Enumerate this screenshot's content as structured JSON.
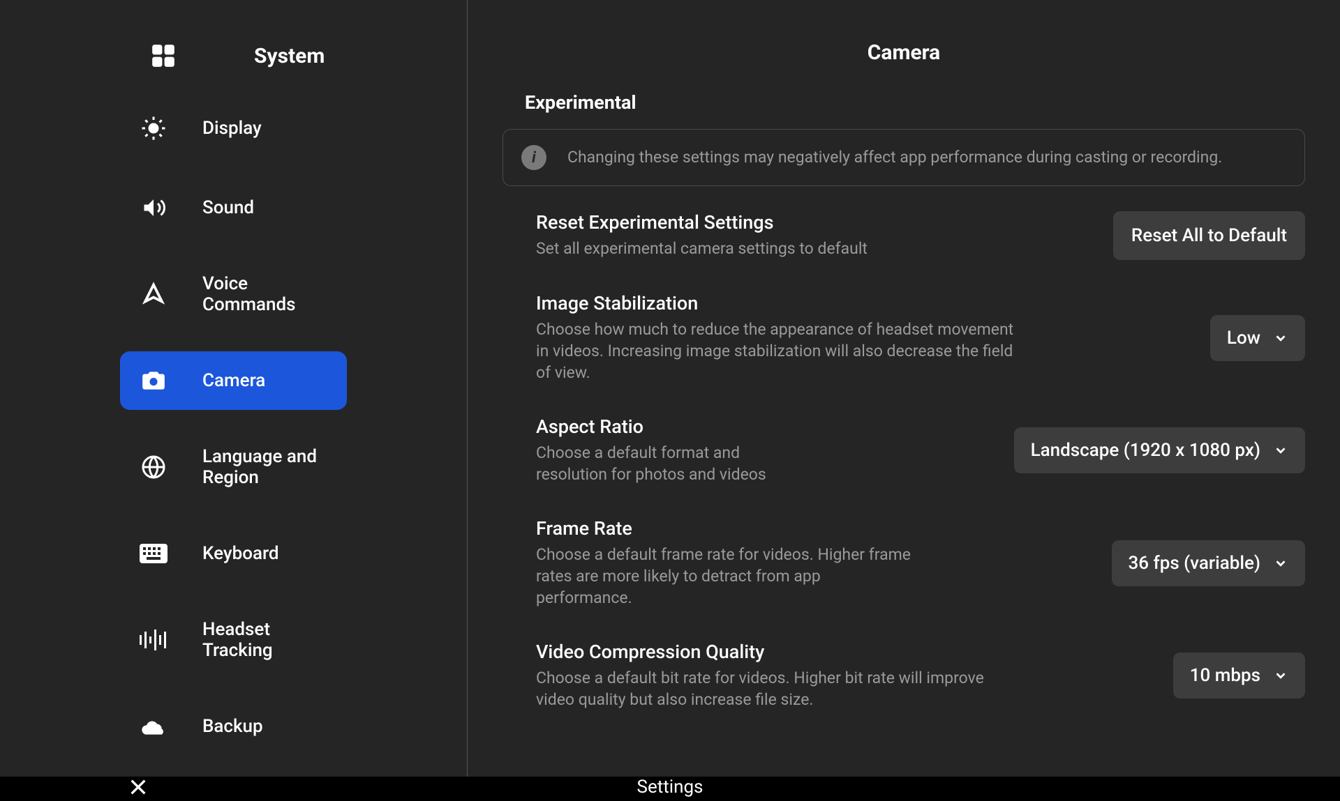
{
  "sidebar": {
    "title": "System",
    "items": [
      {
        "label": "Display",
        "icon": "brightness-icon",
        "active": false
      },
      {
        "label": "Sound",
        "icon": "sound-icon",
        "active": false
      },
      {
        "label": "Voice Commands",
        "icon": "voice-icon",
        "active": false
      },
      {
        "label": "Camera",
        "icon": "camera-icon",
        "active": true
      },
      {
        "label": "Language and Region",
        "icon": "globe-icon",
        "active": false
      },
      {
        "label": "Keyboard",
        "icon": "keyboard-icon",
        "active": false
      },
      {
        "label": "Headset Tracking",
        "icon": "tracking-icon",
        "active": false
      },
      {
        "label": "Backup",
        "icon": "cloud-icon",
        "active": false
      }
    ]
  },
  "content": {
    "header": "Camera",
    "section_title": "Experimental",
    "info_banner": "Changing these settings may negatively affect app performance during casting or recording.",
    "settings": {
      "reset": {
        "title": "Reset Experimental Settings",
        "desc": "Set all experimental camera settings to default",
        "button_label": "Reset All to Default"
      },
      "stabilization": {
        "title": "Image Stabilization",
        "desc": "Choose how much to reduce the appearance of headset movement in videos. Increasing image stabilization will also decrease the field of view.",
        "value": "Low"
      },
      "aspect_ratio": {
        "title": "Aspect Ratio",
        "desc": "Choose a default format and resolution for photos and videos",
        "value": "Landscape (1920 x 1080 px)"
      },
      "frame_rate": {
        "title": "Frame Rate",
        "desc": "Choose a default frame rate for videos. Higher frame rates are more likely to detract from app performance.",
        "value": "36 fps (variable)"
      },
      "compression": {
        "title": "Video Compression Quality",
        "desc": "Choose a default bit rate for videos. Higher bit rate will improve video quality but also increase file size.",
        "value": "10 mbps"
      }
    }
  },
  "bottombar": {
    "title": "Settings"
  }
}
